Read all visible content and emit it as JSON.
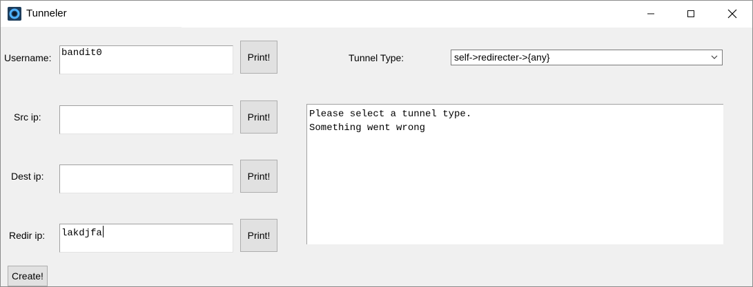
{
  "window": {
    "title": "Tunneler",
    "icon": "tunneler-app-icon"
  },
  "window_controls": {
    "minimize_icon": "minimize-icon",
    "maximize_icon": "maximize-icon",
    "close_icon": "close-icon"
  },
  "fields": [
    {
      "label": "Username:",
      "value": "bandit0",
      "button": "Print!"
    },
    {
      "label": "Src ip:",
      "value": "",
      "button": "Print!"
    },
    {
      "label": "Dest ip:",
      "value": "",
      "button": "Print!"
    },
    {
      "label": "Redir ip:",
      "value": "lakdjfa",
      "button": "Print!"
    }
  ],
  "tunnel_type": {
    "label": "Tunnel Type:",
    "selected": "self->redirecter->{any}"
  },
  "output": {
    "lines": [
      "Please select a tunnel type.",
      "Something went wrong"
    ]
  },
  "create_button": "Create!",
  "colors": {
    "window_bg": "#f0f0f0",
    "button_bg": "#e1e1e1",
    "icon_bg": "#1d3d5c",
    "icon_ring": "#4fb3ff"
  }
}
